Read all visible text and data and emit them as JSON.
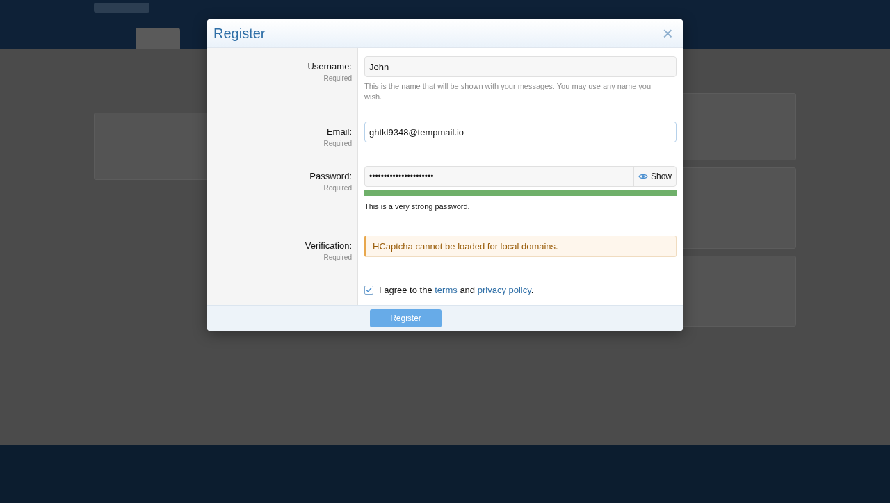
{
  "dialog": {
    "title": "Register",
    "close": "×",
    "fields": [
      {
        "kind": "text",
        "label": "Username:",
        "hint": "Required",
        "value": "John",
        "explain": "This is the name that will be shown with your messages. You may use any name you wish.",
        "focused": false
      },
      {
        "kind": "text",
        "label": "Email:",
        "hint": "Required",
        "value": "ghtkl9348@tempmail.io",
        "focused": true
      },
      {
        "kind": "password",
        "label": "Password:",
        "hint": "Required",
        "value": "••••••••••••••••••••••",
        "show": "Show",
        "level": 1,
        "strength": "This is a very strong password."
      },
      {
        "kind": "notice",
        "label": "Verification:",
        "hint": "Required",
        "notice": "HCaptcha cannot be loaded for local domains."
      }
    ],
    "agree": {
      "checked": true,
      "before": "I agree to the",
      "link1": "terms",
      "middle": "and",
      "link2": "privacy policy",
      "after": "."
    },
    "submit": "Register"
  }
}
